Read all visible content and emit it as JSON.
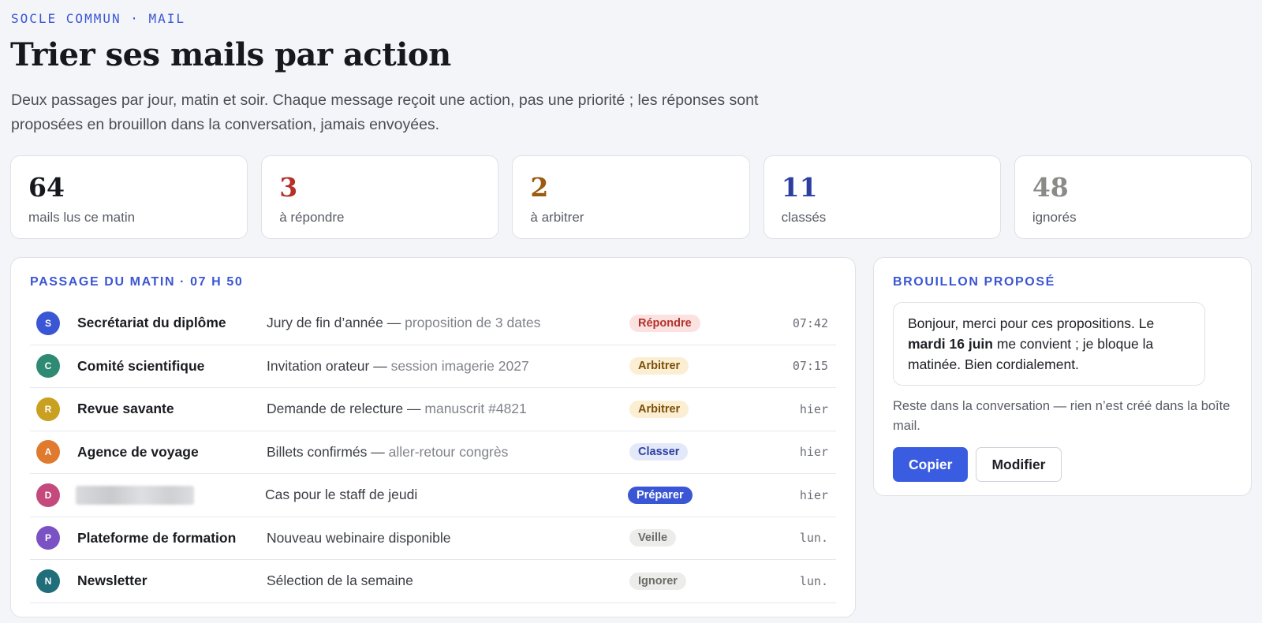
{
  "header": {
    "eyebrow": "SOCLE COMMUN · MAIL",
    "title": "Trier ses mails par action",
    "subtitle": "Deux passages par jour, matin et soir. Chaque message reçoit une action, pas une priorité ; les réponses sont proposées en brouillon dans la conversation, jamais envoyées."
  },
  "stats": [
    {
      "value": "64",
      "label": "mails lus ce matin",
      "color": "#16181d"
    },
    {
      "value": "3",
      "label": "à répondre",
      "color": "#b3312a"
    },
    {
      "value": "2",
      "label": "à arbitrer",
      "color": "#9a5a10"
    },
    {
      "value": "11",
      "label": "classés",
      "color": "#2c3fa0"
    },
    {
      "value": "48",
      "label": "ignorés",
      "color": "#8a8a86"
    }
  ],
  "inbox": {
    "heading": "PASSAGE DU MATIN · 07 H 50",
    "rows": [
      {
        "initial": "S",
        "avatar_color": "#3a56d4",
        "sender": "Secrétariat du diplôme",
        "subject": "Jury de fin d’année — ",
        "subject_detail": "proposition de 3 dates",
        "action": "Répondre",
        "tag_bg": "#fbe2e1",
        "tag_fg": "#b3312a",
        "time": "07:42"
      },
      {
        "initial": "C",
        "avatar_color": "#2f8a74",
        "sender": "Comité scientifique",
        "subject": "Invitation orateur — ",
        "subject_detail": "session imagerie 2027",
        "action": "Arbitrer",
        "tag_bg": "#fbeed2",
        "tag_fg": "#7a4f08",
        "time": "07:15"
      },
      {
        "initial": "R",
        "avatar_color": "#c9a020",
        "sender": "Revue savante",
        "subject": "Demande de relecture — ",
        "subject_detail": "manuscrit #4821",
        "action": "Arbitrer",
        "tag_bg": "#fbeed2",
        "tag_fg": "#7a4f08",
        "time": "hier"
      },
      {
        "initial": "A",
        "avatar_color": "#e07a2e",
        "sender": "Agence de voyage",
        "subject": "Billets confirmés — ",
        "subject_detail": "aller-retour congrès",
        "action": "Classer",
        "tag_bg": "#e4e9fa",
        "tag_fg": "#2c3fa0",
        "time": "hier"
      },
      {
        "initial": "D",
        "avatar_color": "#c44a7c",
        "sender": "",
        "subject": "Cas pour le staff de jeudi",
        "subject_detail": "",
        "action": "Préparer",
        "tag_bg": "#3a56d4",
        "tag_fg": "#ffffff",
        "time": "hier"
      },
      {
        "initial": "P",
        "avatar_color": "#7a52c4",
        "sender": "Plateforme de formation",
        "subject": "Nouveau webinaire disponible",
        "subject_detail": "",
        "action": "Veille",
        "tag_bg": "#ececea",
        "tag_fg": "#6b6b68",
        "time": "lun."
      },
      {
        "initial": "N",
        "avatar_color": "#1f6e7a",
        "sender": "Newsletter",
        "subject": "Sélection de la semaine",
        "subject_detail": "",
        "action": "Ignorer",
        "tag_bg": "#ececea",
        "tag_fg": "#6b6b68",
        "time": "lun."
      }
    ]
  },
  "draft": {
    "heading": "BROUILLON PROPOSÉ",
    "text_before": "Bonjour, merci pour ces propositions. Le ",
    "text_bold": "mardi 16 juin",
    "text_after": " me convient ; je bloque la matinée. Bien cordialement.",
    "note": "Reste dans la conversation — rien n’est créé dans la boîte mail.",
    "copy_label": "Copier",
    "edit_label": "Modifier"
  }
}
